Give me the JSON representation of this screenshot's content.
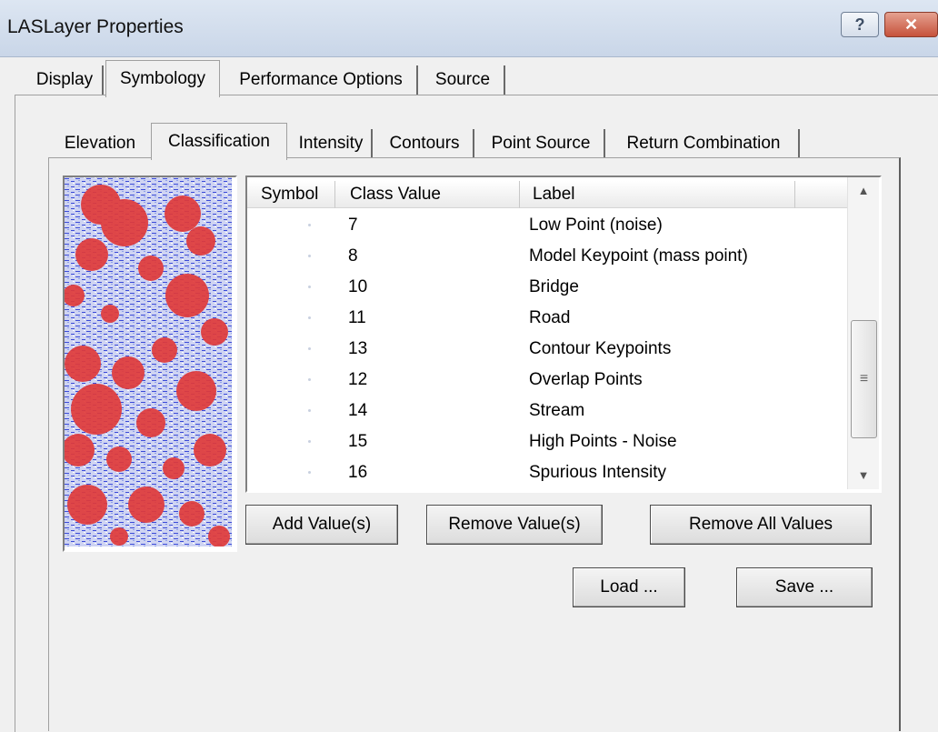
{
  "window": {
    "title": "LASLayer Properties",
    "help": "?",
    "close": "✕"
  },
  "tabs": [
    "Display",
    "Symbology",
    "Performance Options",
    "Source"
  ],
  "subtabs": [
    "Elevation",
    "Classification",
    "Intensity",
    "Contours",
    "Point Source",
    "Return Combination"
  ],
  "list": {
    "headers": [
      "Symbol",
      "Class Value",
      "Label"
    ],
    "rows": [
      {
        "value": "7",
        "label": "Low Point (noise)"
      },
      {
        "value": "8",
        "label": "Model Keypoint (mass point)"
      },
      {
        "value": "10",
        "label": "Bridge"
      },
      {
        "value": "11",
        "label": "Road"
      },
      {
        "value": "13",
        "label": "Contour Keypoints"
      },
      {
        "value": "12",
        "label": "Overlap Points"
      },
      {
        "value": "14",
        "label": "Stream"
      },
      {
        "value": "15",
        "label": "High Points - Noise"
      },
      {
        "value": "16",
        "label": "Spurious Intensity"
      }
    ]
  },
  "buttons": {
    "add": "Add Value(s)",
    "remove": "Remove Value(s)",
    "remove_all": "Remove All Values",
    "load": "Load ...",
    "save": "Save ..."
  },
  "icons": {
    "scroll_up": "▲",
    "scroll_down": "▼",
    "grip": "≡"
  },
  "colors": {
    "preview_red": "#e03a3a",
    "preview_blue": "#3a4ad8"
  }
}
